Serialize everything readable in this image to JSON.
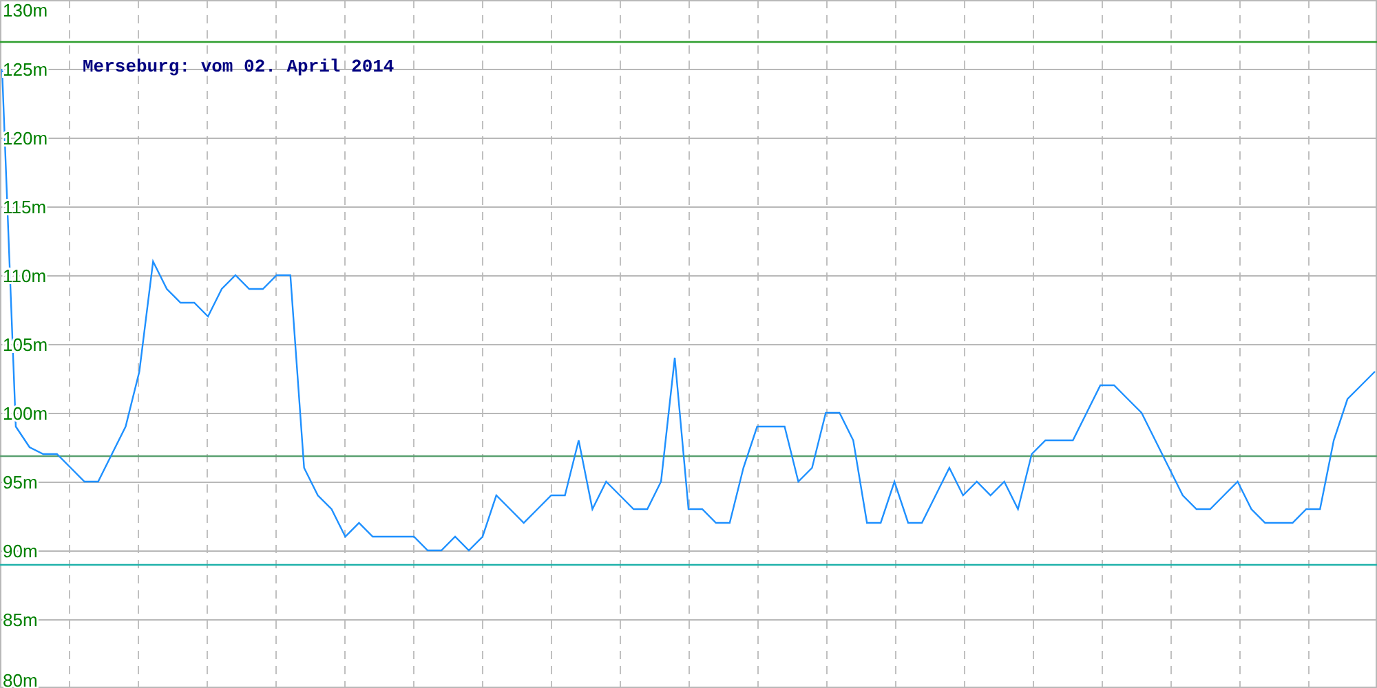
{
  "chart_data": {
    "type": "line",
    "title": "Merseburg: vom 02. April 2014",
    "ylim": [
      80,
      130
    ],
    "yticks": [
      {
        "value": 80,
        "label": "80m"
      },
      {
        "value": 85,
        "label": "85m"
      },
      {
        "value": 90,
        "label": "90m"
      },
      {
        "value": 95,
        "label": "95m"
      },
      {
        "value": 100,
        "label": "100m"
      },
      {
        "value": 105,
        "label": "105m"
      },
      {
        "value": 110,
        "label": "110m"
      },
      {
        "value": 115,
        "label": "115m"
      },
      {
        "value": 120,
        "label": "120m"
      },
      {
        "value": 125,
        "label": "125m"
      },
      {
        "value": 130,
        "label": "130m"
      }
    ],
    "series": [
      {
        "color": "#1e90ff",
        "values": [
          125,
          99,
          97.5,
          97,
          97,
          96,
          95,
          95,
          97,
          99,
          103,
          111,
          109,
          108,
          108,
          107,
          109,
          110,
          109,
          109,
          110,
          110,
          96,
          94,
          93,
          91,
          92,
          91,
          91,
          91,
          91,
          90,
          90,
          91,
          90,
          91,
          94,
          93,
          92,
          93,
          94,
          94,
          98,
          93,
          95,
          94,
          93,
          93,
          95,
          104,
          93,
          93,
          92,
          92,
          96,
          99,
          99,
          99,
          95,
          96,
          100,
          100,
          98,
          92,
          92,
          95,
          92,
          92,
          94,
          96,
          94,
          95,
          94,
          95,
          93,
          97,
          98,
          98,
          98,
          100,
          102,
          102,
          101,
          100,
          98,
          96,
          94,
          93,
          93,
          94,
          95,
          93,
          92,
          92,
          92,
          93,
          93,
          98,
          101,
          102,
          103
        ]
      }
    ],
    "grid": true,
    "ref_lines": [
      {
        "axis": "y",
        "value": 127,
        "color": "#2e9e2e"
      },
      {
        "axis": "y",
        "value": 96.9,
        "color": "#5aa070"
      },
      {
        "axis": "y",
        "value": 89,
        "color": "#20b2aa"
      }
    ]
  }
}
